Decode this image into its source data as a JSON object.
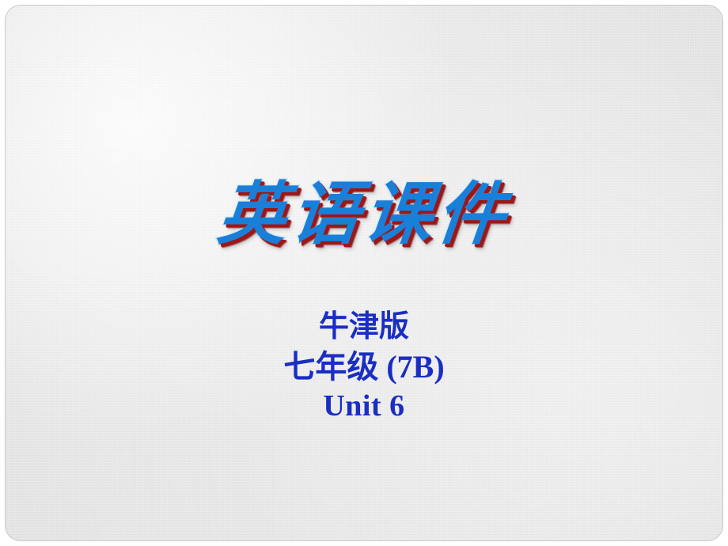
{
  "slide": {
    "background_color": "#e9e9e9",
    "border_color": "#c9c9c9",
    "page_margin_color": "#ffffff"
  },
  "title": {
    "text": "英语课件",
    "fill_color": "#1a7fd8",
    "highlight_color": "#c9e2f6",
    "shadow_color": "#9e1616",
    "style": "wordart-brush-italic"
  },
  "subtitle": {
    "lines": [
      {
        "text": "牛津版",
        "role": "publisher"
      },
      {
        "text": "七年级 (7B)",
        "role": "grade-and-book"
      },
      {
        "text": "Unit 6",
        "role": "unit"
      }
    ],
    "color": "#1a2ec4"
  }
}
